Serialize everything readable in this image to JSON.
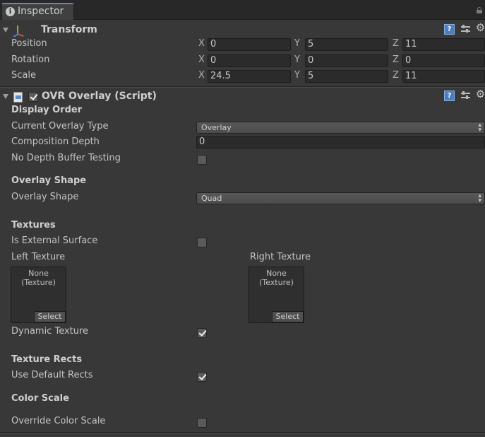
{
  "window": {
    "tab_title": "Inspector"
  },
  "transform": {
    "title": "Transform",
    "rows": [
      {
        "label": "Position",
        "x": "0",
        "y": "5",
        "z": "11"
      },
      {
        "label": "Rotation",
        "x": "0",
        "y": "0",
        "z": "0"
      },
      {
        "label": "Scale",
        "x": "24.5",
        "y": "5",
        "z": "11"
      }
    ],
    "axis_x": "X",
    "axis_y": "Y",
    "axis_z": "Z"
  },
  "overlay": {
    "title": "OVR Overlay (Script)",
    "enabled": true,
    "display_order_heading": "Display Order",
    "current_overlay_type_label": "Current Overlay Type",
    "current_overlay_type_value": "Overlay",
    "composition_depth_label": "Composition Depth",
    "composition_depth_value": "0",
    "no_depth_buffer_label": "No Depth Buffer Testing",
    "no_depth_buffer_checked": false,
    "overlay_shape_heading": "Overlay Shape",
    "overlay_shape_label": "Overlay Shape",
    "overlay_shape_value": "Quad",
    "textures_heading": "Textures",
    "is_external_surface_label": "Is External Surface",
    "is_external_surface_checked": false,
    "left_texture_label": "Left Texture",
    "right_texture_label": "Right Texture",
    "texture_none_text": "None\n(Texture)",
    "select_label": "Select",
    "dynamic_texture_label": "Dynamic Texture",
    "dynamic_texture_checked": true,
    "texture_rects_heading": "Texture Rects",
    "use_default_rects_label": "Use Default Rects",
    "use_default_rects_checked": true,
    "color_scale_heading": "Color Scale",
    "override_color_scale_label": "Override Color Scale",
    "override_color_scale_checked": false
  },
  "colors": {
    "background": "#383838",
    "accent": "#5a8ac8",
    "help_icon": "#4b7fbf"
  }
}
